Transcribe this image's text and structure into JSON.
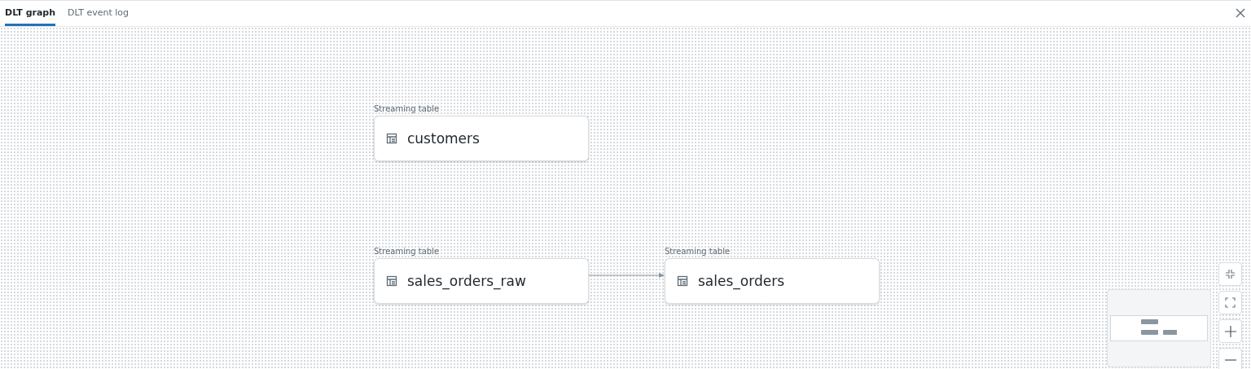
{
  "tabs": [
    {
      "label": "DLT graph",
      "selected": true
    },
    {
      "label": "DLT event log",
      "selected": false
    }
  ],
  "nodes": [
    {
      "type_label": "Streaming table",
      "name": "customers"
    },
    {
      "type_label": "Streaming table",
      "name": "sales_orders_raw"
    },
    {
      "type_label": "Streaming table",
      "name": "sales_orders"
    }
  ]
}
